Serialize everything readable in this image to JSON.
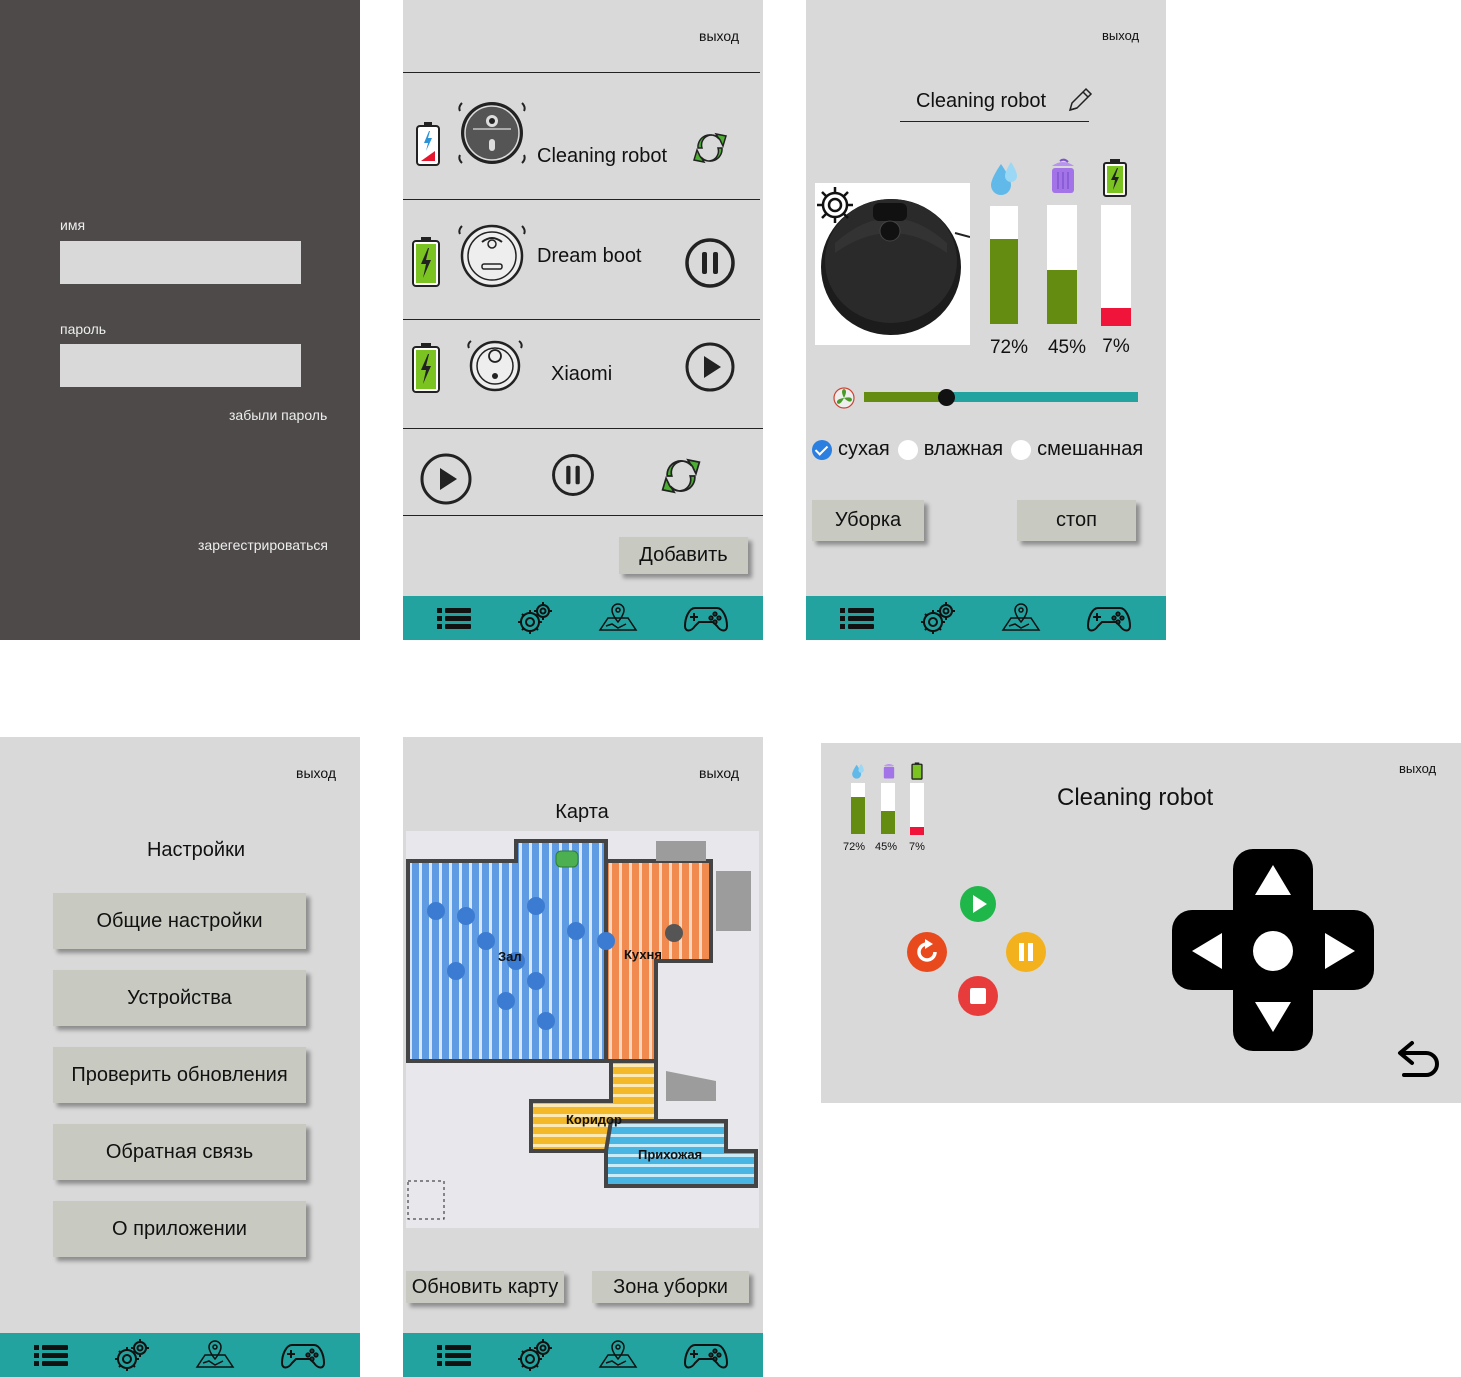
{
  "common": {
    "exit_label": "выход"
  },
  "login": {
    "name_label": "имя",
    "name_value": "",
    "password_label": "пароль",
    "password_value": "",
    "forgot_label": "забыли пароль",
    "register_label": "зарегестрироваться"
  },
  "devices": {
    "items": [
      {
        "name": "Cleaning robot",
        "action": "sync",
        "battery_level": 0.2,
        "battery_icon": "battery-charging-low-icon",
        "robot_icon": "robot-vacuum-icon"
      },
      {
        "name": "Dream boot",
        "action": "pause",
        "battery_level": 1.0,
        "battery_icon": "battery-full-icon",
        "robot_icon": "robot-vacuum-icon"
      },
      {
        "name": "Xiaomi",
        "action": "play",
        "battery_level": 1.0,
        "battery_icon": "battery-full-icon",
        "robot_icon": "robot-vacuum-icon"
      }
    ],
    "add_label": "Добавить"
  },
  "robot": {
    "name": "Cleaning robot",
    "gauges": [
      {
        "icon": "water-drop-icon",
        "value": "72%",
        "level": 0.72,
        "color": "#648c11"
      },
      {
        "icon": "trash-bin-icon",
        "value": "45%",
        "level": 0.45,
        "color": "#648c11"
      },
      {
        "icon": "battery-icon",
        "value": "7%",
        "level": 0.15,
        "color": "#f0133a"
      }
    ],
    "suction_level": 0.3,
    "modes": [
      {
        "label": "сухая",
        "selected": true
      },
      {
        "label": "влажная",
        "selected": false
      },
      {
        "label": "смешанная",
        "selected": false
      }
    ],
    "clean_label": "Уборка",
    "stop_label": "стоп"
  },
  "settings": {
    "title": "Настройки",
    "items": [
      "Общие настройки",
      "Устройства",
      "Проверить обновления",
      "Обратная связь",
      "О приложении"
    ]
  },
  "map": {
    "title": "Карта",
    "rooms": [
      "Зал",
      "Кухня",
      "Коридор",
      "Прихожая"
    ],
    "refresh_label": "Обновить карту",
    "zone_label": "Зона уборки"
  },
  "remote": {
    "name": "Cleaning robot",
    "gauges": [
      {
        "value": "72%",
        "level": 0.72
      },
      {
        "value": "45%",
        "level": 0.45
      },
      {
        "value": "7%",
        "level": 0.15
      }
    ]
  },
  "colors": {
    "accent": "#23a39f",
    "dark_bg": "#4d4a49",
    "panel_bg": "#d9d9d9",
    "button_bg": "#c8c9c0",
    "green_level": "#648c11",
    "red_level": "#f0133a"
  }
}
